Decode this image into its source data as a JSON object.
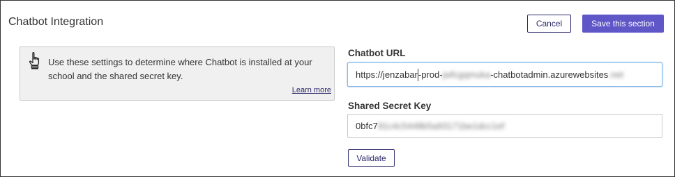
{
  "section": {
    "title": "Chatbot Integration"
  },
  "actions": {
    "cancel_label": "Cancel",
    "save_label": "Save this section"
  },
  "info": {
    "icon": "pointing-hand-icon",
    "text": "Use these settings to determine where Chatbot is installed at your school and the shared secret key.",
    "learn_more_label": "Learn more"
  },
  "chatbot_url": {
    "label": "Chatbot URL",
    "value_visible_before_cursor": "https://jenzabar",
    "value_visible_after_cursor": "-prod-",
    "value_obscured": "jwfcgqmuka",
    "value_visible_end": "-chatbotadmin.azurewebsites",
    "value_obscured_end": ".net"
  },
  "shared_secret": {
    "label": "Shared Secret Key",
    "value_visible": "0bfc7",
    "value_obscured": "91c4c5448b5a93171be1dcc1ef"
  },
  "validate": {
    "label": "Validate"
  },
  "colors": {
    "primary": "#5f56c8",
    "primary_outline": "#2d2a6b",
    "info_bg": "#f0f0f0",
    "focus_border": "#86b7e6"
  }
}
